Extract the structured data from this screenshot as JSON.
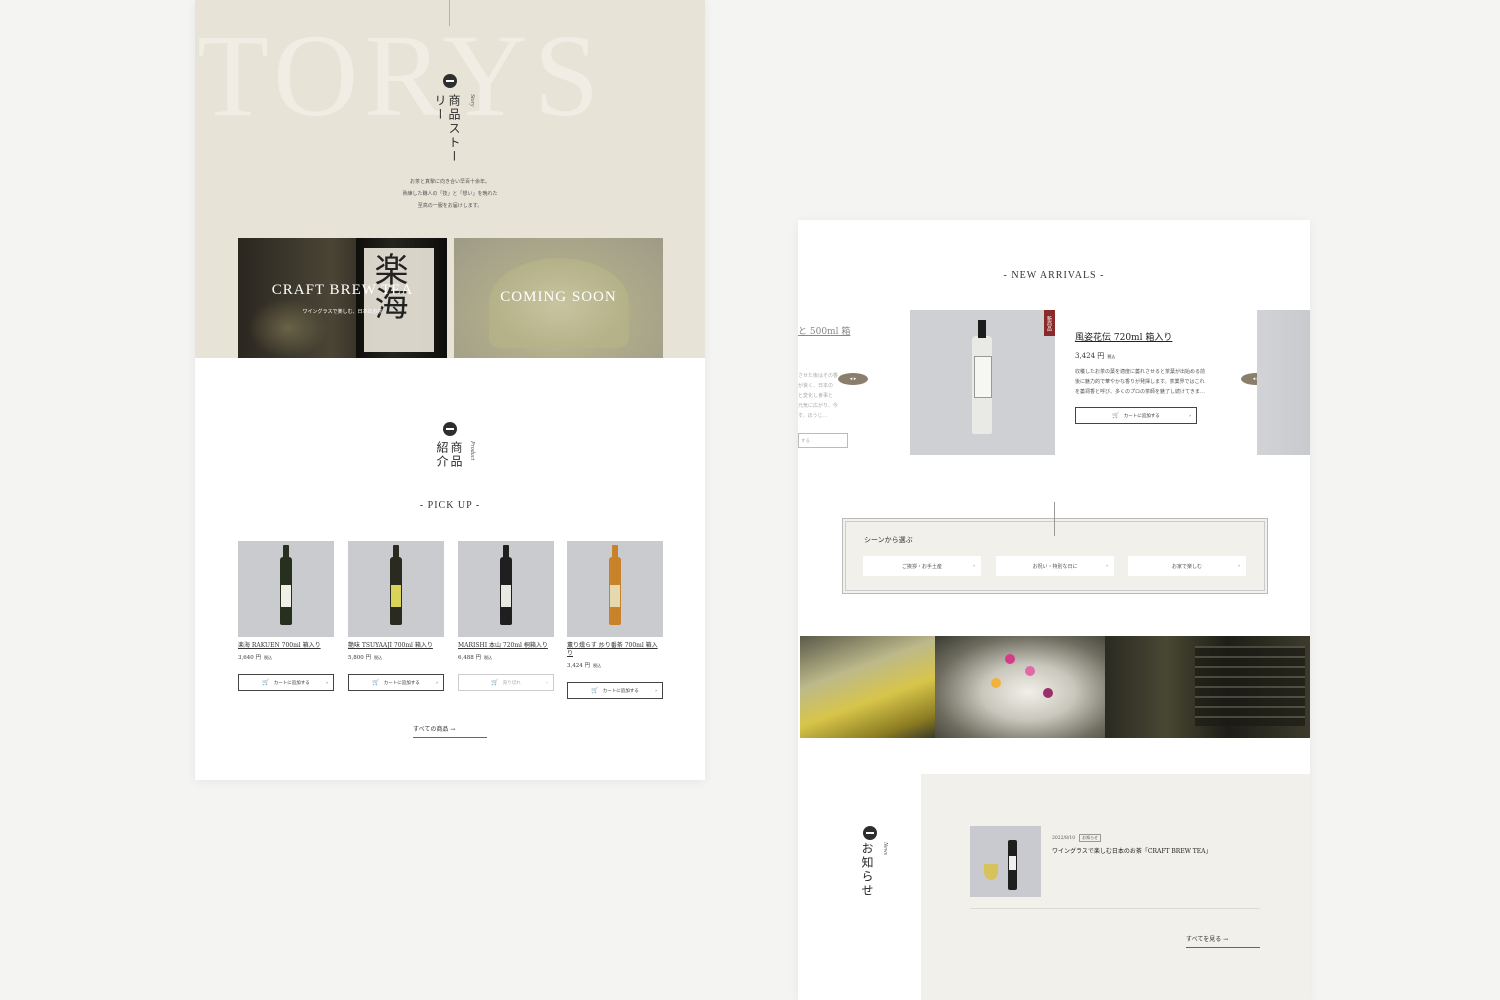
{
  "left_page": {
    "story": {
      "bg_text": "TORYS",
      "title": "商品ストーリー",
      "title_en": "Story",
      "lines": [
        "お茶と真摯に向き合い早百十余年。",
        "熟練した職人の「技」と「想い」を晩れた",
        "至高の一服をお届けします。"
      ],
      "tiles": [
        {
          "title": "CRAFT BREW TEA",
          "subtitle": "ワイングラスで楽しむ、日本のお茶",
          "label_kanji": "楽海"
        },
        {
          "title": "COMING SOON",
          "subtitle": ""
        }
      ]
    },
    "products_section": {
      "title": "商品紹介",
      "title_en": "Product",
      "pickup": "PICK UP",
      "items": [
        {
          "name": "楽海 RAKUEN 700ml 箱入り",
          "price": "3,640 円",
          "tax": "税込",
          "button": "カートに追加する",
          "bottle_color": "#27301f",
          "label_color": "#f1f0e6",
          "disabled": false
        },
        {
          "name": "艶味 TSUYAAJI 700ml 箱入り",
          "price": "5,800 円",
          "tax": "税込",
          "button": "カートに追加する",
          "bottle_color": "#2a2a1e",
          "label_color": "#d9d35a",
          "disabled": false
        },
        {
          "name": "MARISHI 本山 720ml 桐箱入り",
          "price": "6,488 円",
          "tax": "税込",
          "button": "売り切れ",
          "bottle_color": "#1f1f1f",
          "label_color": "#e9e9e4",
          "disabled": true
        },
        {
          "name": "薫り燻らす 炒り番茶 700ml 箱入り",
          "price": "3,424 円",
          "tax": "税込",
          "button": "カートに追加する",
          "bottle_color": "#c8832a",
          "label_color": "#e6d9b0",
          "disabled": false
        }
      ],
      "view_all": "すべての商品 →"
    }
  },
  "right_page": {
    "new_arrivals": {
      "heading": "NEW ARRIVALS",
      "prev": {
        "name": "と 500ml 箱",
        "desc_lines": [
          "させた後はその香",
          "が良く、日本の",
          "と変化し食事と",
          "元気に広がり、今",
          "す。ほうじ…"
        ],
        "button": "する"
      },
      "current": {
        "badge": "新商品",
        "name": "風姿花伝 720ml 箱入り",
        "price": "3,424 円",
        "tax": "税込",
        "desc": "収穫したお茶の葉を適度に萎れさせると茶葉が出始める前後に魅力的で華やかな香りが発揮します。茶業界ではこれを萎凋香と呼び、多くのプロの茶師を魅了し続けてきま…",
        "button": "カートに追加する"
      },
      "arrow_label": "◀▶"
    },
    "scene": {
      "title": "シーンから選ぶ",
      "options": [
        "ご挨拶・お手土産",
        "お祝い・特別な日に",
        "お家で楽しむ"
      ]
    },
    "news": {
      "title": "お知らせ",
      "title_en": "News",
      "items": [
        {
          "date": "2022/8/10",
          "tag": "お知らせ",
          "title": "ワイングラスで楽しむ日本のお茶「CRAFT BREW TEA」"
        }
      ],
      "view_all": "すべてを見る →"
    }
  }
}
